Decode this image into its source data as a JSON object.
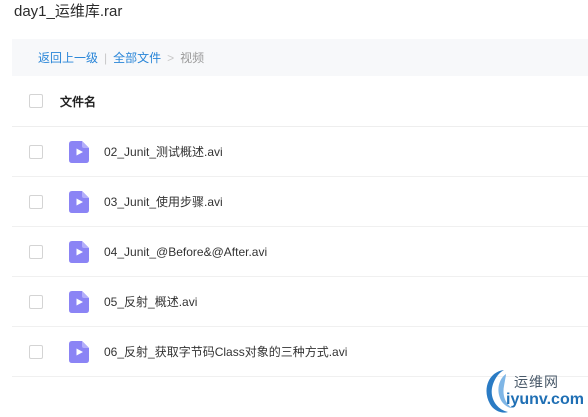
{
  "archive": {
    "title": "day1_运维库.rar"
  },
  "breadcrumb": {
    "back_label": "返回上一级",
    "divider": "|",
    "all_files_label": "全部文件",
    "chevron": ">",
    "current_label": "视频"
  },
  "table": {
    "header": {
      "name_label": "文件名"
    },
    "files": [
      {
        "name": "02_Junit_测试概述.avi",
        "icon": "video-file-icon"
      },
      {
        "name": "03_Junit_使用步骤.avi",
        "icon": "video-file-icon"
      },
      {
        "name": "04_Junit_@Before&@After.avi",
        "icon": "video-file-icon"
      },
      {
        "name": "05_反射_概述.avi",
        "icon": "video-file-icon"
      },
      {
        "name": "06_反射_获取字节码Class对象的三种方式.avi",
        "icon": "video-file-icon"
      }
    ]
  },
  "watermark": {
    "chinese": "运维网",
    "domain": "iyunv.com"
  },
  "colors": {
    "link": "#2a86d8",
    "icon_fill": "#8b84f5",
    "breadcrumb_bg": "#f7f8fa"
  }
}
